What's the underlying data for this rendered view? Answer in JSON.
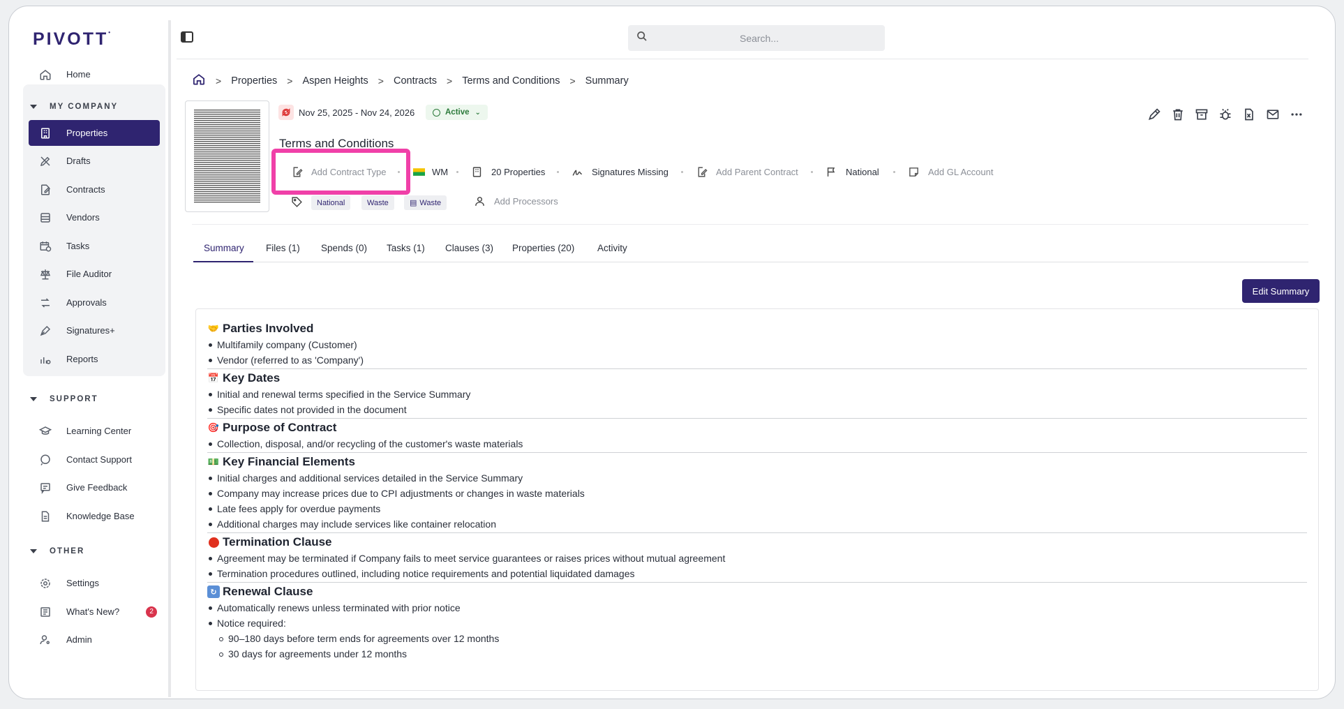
{
  "app": {
    "logo": "PIVOTT"
  },
  "search": {
    "placeholder": "Search..."
  },
  "sidebar": {
    "home": "Home",
    "section_company": "MY COMPANY",
    "company_items": [
      "Properties",
      "Drafts",
      "Contracts",
      "Vendors",
      "Tasks",
      "File Auditor",
      "Approvals",
      "Signatures+",
      "Reports"
    ],
    "section_support": "SUPPORT",
    "support_items": [
      "Learning Center",
      "Contact Support",
      "Give Feedback",
      "Knowledge Base"
    ],
    "section_other": "OTHER",
    "other_items": [
      "Settings",
      "What's New?",
      "Admin"
    ],
    "whats_new_count": "2",
    "active_item": "Properties"
  },
  "breadcrumb": [
    "Properties",
    "Aspen Heights",
    "Contracts",
    "Terms and Conditions",
    "Summary"
  ],
  "contract": {
    "dates": "Nov 25, 2025 - Nov 24, 2026",
    "status": "Active",
    "title": "Terms and Conditions",
    "contract_type": "Add Contract Type",
    "vendor": "WM",
    "properties": "20 Properties",
    "signatures": "Signatures Missing",
    "parent_contract": "Add Parent Contract",
    "scope": "National",
    "gl_account": "Add GL Account",
    "tags": [
      "National",
      "Waste",
      "Waste"
    ],
    "processors": "Add Processors"
  },
  "tabs": [
    "Summary",
    "Files (1)",
    "Spends (0)",
    "Tasks (1)",
    "Clauses (3)",
    "Properties (20)",
    "Activity"
  ],
  "edit_summary_label": "Edit Summary",
  "summary": [
    {
      "heading": "Parties Involved",
      "icon": "handshake-icon",
      "items": [
        "Multifamily company (Customer)",
        "Vendor (referred to as 'Company')"
      ]
    },
    {
      "heading": "Key Dates",
      "icon": "calendar-icon",
      "items": [
        "Initial and renewal terms specified in the Service Summary",
        "Specific dates not provided in the document"
      ]
    },
    {
      "heading": "Purpose of Contract",
      "icon": "target-icon",
      "items": [
        "Collection, disposal, and/or recycling of the customer's waste materials"
      ]
    },
    {
      "heading": "Key Financial Elements",
      "icon": "money-icon",
      "items": [
        "Initial charges and additional services detailed in the Service Summary",
        "Company may increase prices due to CPI adjustments or changes in waste materials",
        "Late fees apply for overdue payments",
        "Additional charges may include services like container relocation"
      ]
    },
    {
      "heading": "Termination Clause",
      "icon": "red-circle-icon",
      "items": [
        "Agreement may be terminated if Company fails to meet service guarantees or raises prices without mutual agreement",
        "Termination procedures outlined, including notice requirements and potential liquidated damages"
      ]
    },
    {
      "heading": "Renewal Clause",
      "icon": "repeat-icon",
      "items": [
        "Automatically renews unless terminated with prior notice",
        "Notice required:"
      ],
      "subitems": [
        "90–180 days before term ends for agreements over 12 months",
        "30 days for agreements under 12 months"
      ]
    }
  ]
}
